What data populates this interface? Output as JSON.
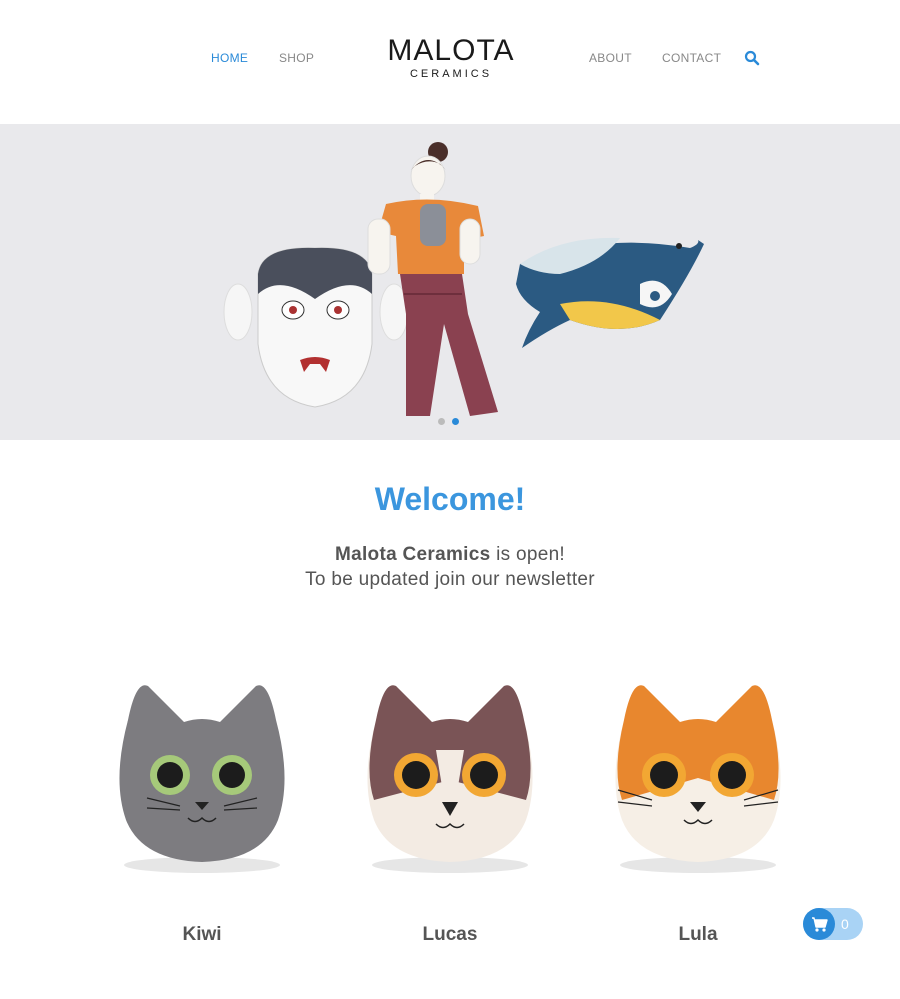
{
  "nav": {
    "left": [
      {
        "label": "HOME",
        "active": true
      },
      {
        "label": "SHOP",
        "active": false
      }
    ],
    "right": [
      {
        "label": "ABOUT"
      },
      {
        "label": "CONTACT"
      }
    ]
  },
  "logo": {
    "main": "MALOTA",
    "sub": "CERAMICS"
  },
  "hero": {
    "slides": 2,
    "active_slide": 2
  },
  "welcome": {
    "title": "Welcome!",
    "brand": "Malota Ceramics",
    "line1_rest": " is open!",
    "line2": "To be updated join our newsletter"
  },
  "products": [
    {
      "name": "Kiwi"
    },
    {
      "name": "Lucas"
    },
    {
      "name": "Lula"
    }
  ],
  "cart": {
    "count": "0"
  },
  "colors": {
    "accent": "#2a8ad8",
    "title": "#3b96de",
    "hero_bg": "#e9e9ec",
    "text": "#555555"
  }
}
